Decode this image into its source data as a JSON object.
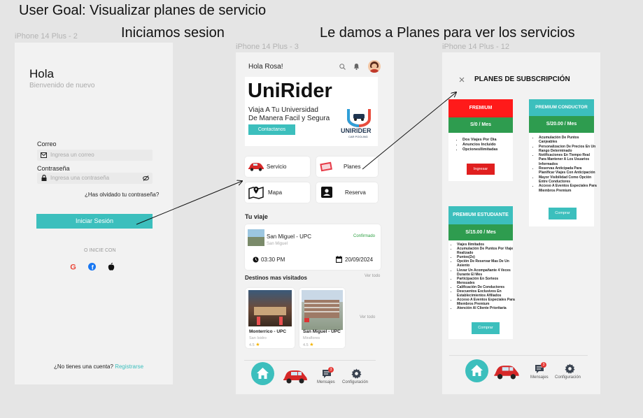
{
  "captions": {
    "goal": "User Goal: Visualizar planes de servicio",
    "step1": "Iniciamos sesion",
    "step2": "Le damos a Planes para ver los servicios"
  },
  "frames": {
    "login": "iPhone 14 Plus - 2",
    "home": "iPhone 14 Plus - 3",
    "plans": "iPhone 14 Plus - 12"
  },
  "login": {
    "greeting": "Hola",
    "subtitle": "Bienvenido de nuevo",
    "email_label": "Correo",
    "email_placeholder": "Ingresa un correo",
    "password_label": "Contraseña",
    "password_placeholder": "Ingresa una contraseña",
    "forgot": "¿Has olvidado tu contraseña?",
    "submit": "Iniciar Sesión",
    "or_continue": "O INICIE CON",
    "no_account": "¿No tienes una cuenta?",
    "register": "Registrarse"
  },
  "home": {
    "greeting": "Hola Rosa!",
    "brand": "UniRider",
    "tagline_1": "Viaja A Tu Universidad",
    "tagline_2": "De Manera Facil y Segura",
    "contact": "Contactanos",
    "logo_text": "UNIRIDER",
    "logo_sub": "CAR POOLING",
    "menu": [
      {
        "label": "Servicio"
      },
      {
        "label": "Planes"
      },
      {
        "label": "Mapa"
      },
      {
        "label": "Reserva"
      }
    ],
    "trip_section": "Tu viaje",
    "trip": {
      "title": "San Miguel - UPC",
      "subtitle": "San Miguel",
      "status": "Confirmado",
      "time": "03:30 PM",
      "date": "20/09/2024"
    },
    "visited_section": "Destinos mas visitados",
    "see_all": "Ver todo",
    "see_all_2": "Ver todo",
    "destinations": [
      {
        "title": "Monterrico - UPC",
        "subtitle": "San Isidro",
        "rating": "4.5"
      },
      {
        "title": "San Miguel - UPC",
        "subtitle": "Miraflores",
        "rating": "4.5"
      }
    ],
    "nav": {
      "messages": "Mensajes",
      "settings": "Configuración",
      "badge": "3"
    }
  },
  "plans": {
    "title": "PLANES DE SUBSCRIPCIÓN",
    "cards": [
      {
        "name": "FREMIUM",
        "price": "S/0 / Mes",
        "header_color": "#ff1a1a",
        "features": [
          "Dos Viajes Por Dia",
          "Anuncios Incluido",
          "OpcionesIlimitadas"
        ],
        "button": "Ingresar",
        "button_color": "#e01f1f"
      },
      {
        "name": "PREMIUM CONDUCTOR",
        "price": "S/20.00 / Mes",
        "header_color": "#3cbfbd",
        "features": [
          "Acumulación De Puntos Canjeables",
          "Personalizacion De Precios En Un Rango Determinado",
          "Notificaciones En Tiempo Real Para Mantener A Los Usuarios Informados",
          "Reservas Anticipada Para Planificar Viajes Con Anticipación",
          "Mayor Visibilidad Como Opción Entre Conductores",
          "Acceso A Eventos Especiales Para Miembros Premium"
        ],
        "button": "Comprar",
        "button_color": "#3cbfbd"
      },
      {
        "name": "PREMIUM ESTUDIANTE",
        "price": "S/15.00 / Mes",
        "header_color": "#3cbfbd",
        "features": [
          "Viajes Ilimitados",
          "Acumulación De Puntos Por Viaje Realizado",
          "Puntos(2x)",
          "Opción De Reservar Mas De Un Asiento",
          "Llevar Un Acompañante 4 Veces Durante El Mes",
          "Participación En Sorteos Mensuales",
          "Calificación De Conductores",
          "Descuentos Exclusivos En Establecimientos Afiliados",
          "Acceso A Eventos Especiales Para Miembros Premium",
          "Atención Al Cliente Prioritaria"
        ],
        "button": "Comprar",
        "button_color": "#3cbfbd"
      }
    ],
    "nav": {
      "messages": "Mensajes",
      "settings": "Configuración",
      "badge": "3"
    }
  },
  "colors": {
    "teal": "#3cbfbd",
    "green": "#2e9c4f",
    "red": "#ff1a1a"
  }
}
